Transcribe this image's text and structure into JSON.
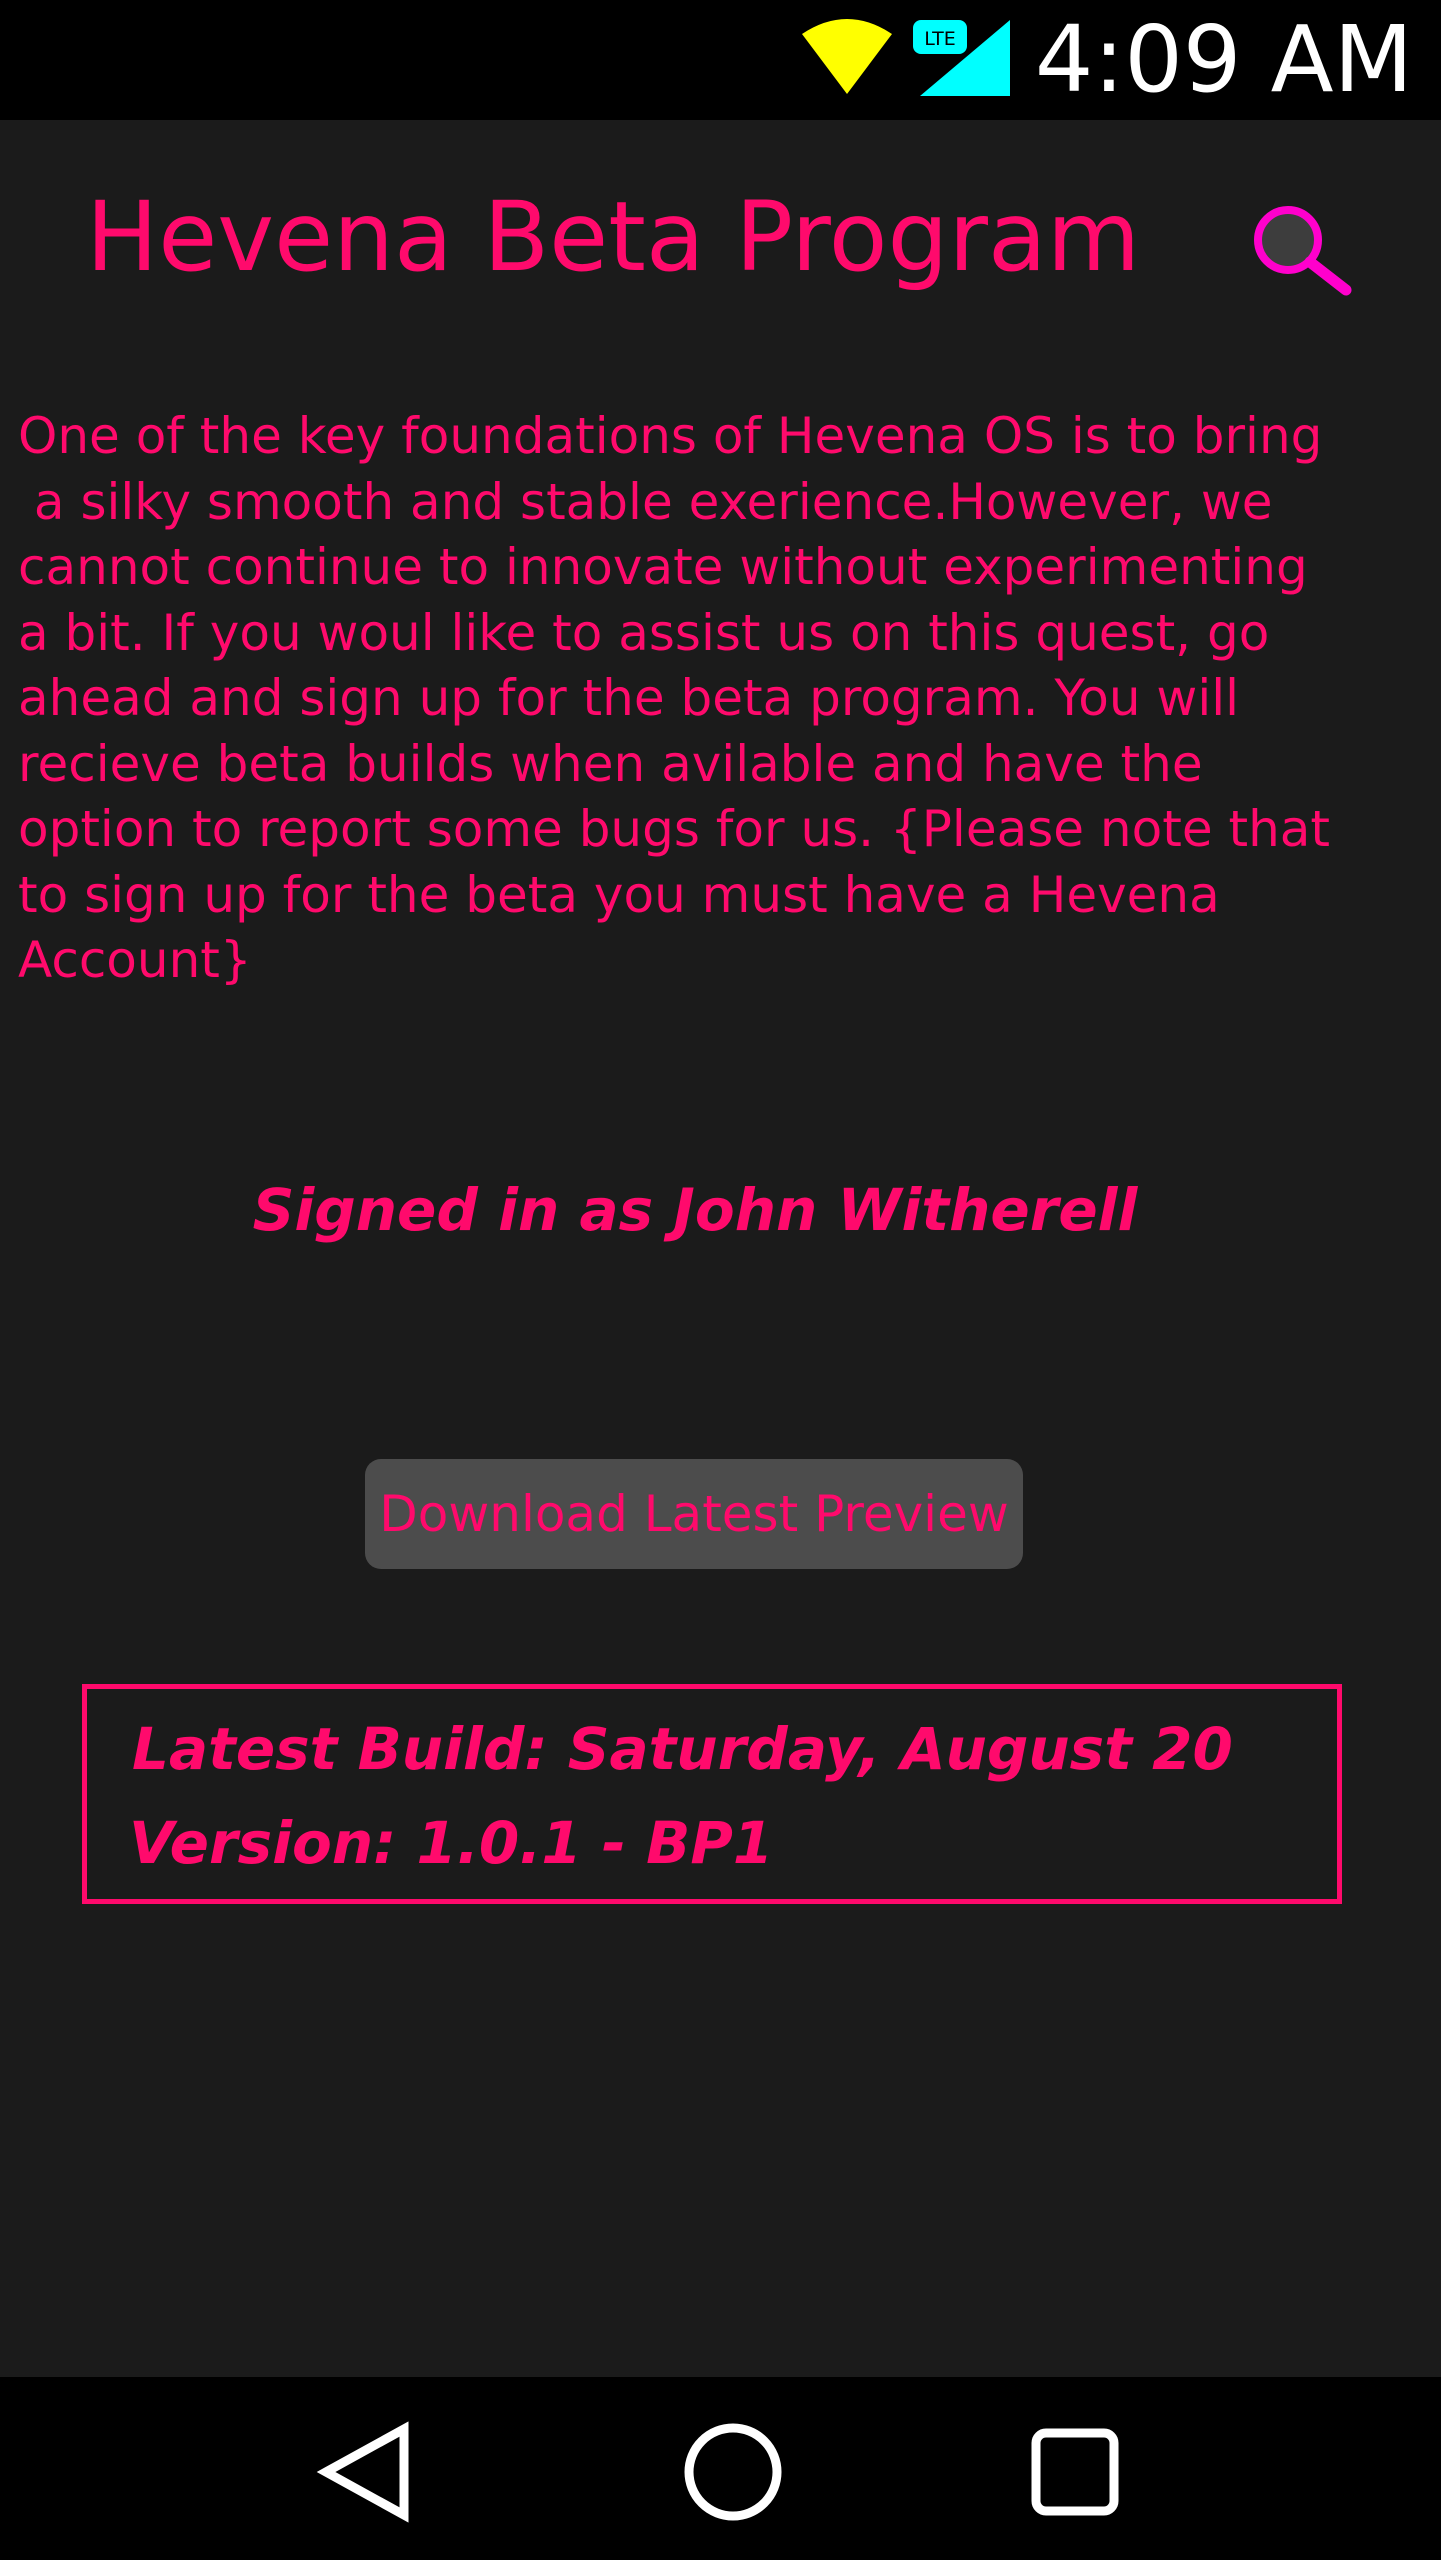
{
  "status_bar": {
    "time": "4:09 AM",
    "network_label": "LTE",
    "wifi_icon": "wifi-icon",
    "signal_icon": "cellular-signal-icon",
    "wifi_color": "#ffff00",
    "signal_color": "#00ffff"
  },
  "header": {
    "title": "Hevena Beta Program",
    "search_icon": "search-icon"
  },
  "main": {
    "description": "One of the key foundations of Hevena OS is to bring\n a silky smooth and stable exerience.However, we\ncannot continue to innovate without experimenting\na bit. If you woul like to assist us on this quest, go\nahead and sign up for the beta program. You will\nrecieve beta builds when avilable and have the\noption to report some bugs for us. {Please note that\nto sign up for the beta you must have a Hevena\nAccount}",
    "signed_in_text": "Signed in as John Witherell",
    "download_button_label": "Download Latest Preview",
    "build_info": {
      "latest_build": "Latest Build: Saturday, August 20",
      "version": "Version: 1.0.1 - BP1"
    }
  },
  "nav_bar": {
    "back_icon": "back-icon",
    "home_icon": "home-icon",
    "recents_icon": "recents-icon"
  },
  "colors": {
    "accent": "#ff0a6c",
    "search_icon": "#ff00cc",
    "background": "#1b1b1b",
    "button_background": "#4c4c4c"
  }
}
